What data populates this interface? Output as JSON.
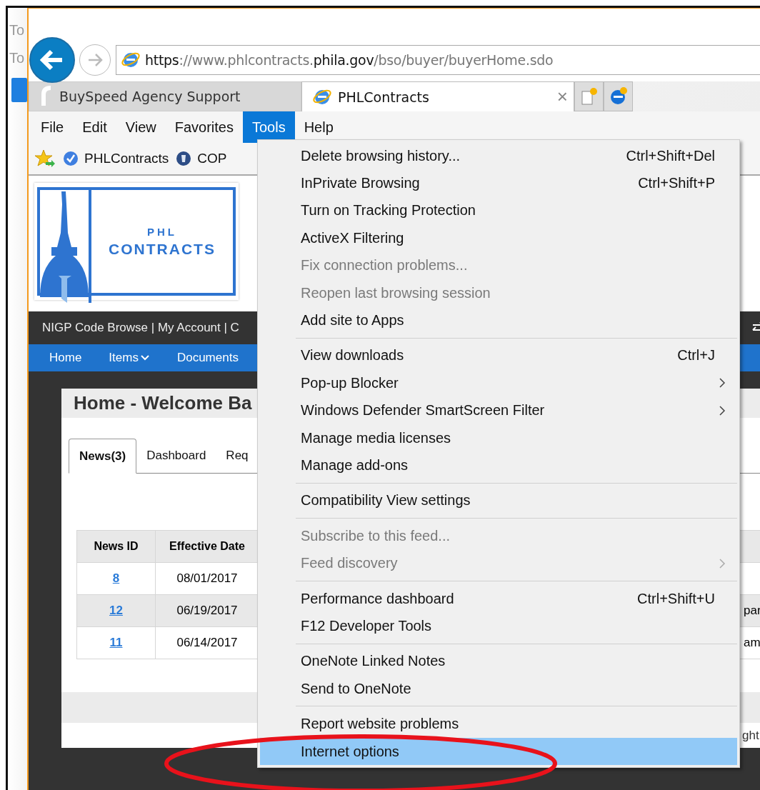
{
  "background_window": {
    "fragments": [
      "To",
      "To"
    ]
  },
  "browser": {
    "address": {
      "url_parts": [
        {
          "text": "https",
          "strong": true
        },
        {
          "text": "://www.phlcontracts.",
          "strong": false
        },
        {
          "text": "phila.gov",
          "strong": true
        },
        {
          "text": "/bso/buyer/buyerHome.sdo",
          "strong": false
        }
      ]
    },
    "tabs": [
      {
        "title": "BuySpeed Agency Support",
        "selected": false
      },
      {
        "title": "PHLContracts",
        "selected": true,
        "close": "×"
      }
    ],
    "menu_bar": [
      {
        "label": "File",
        "selected": false
      },
      {
        "label": "Edit",
        "selected": false
      },
      {
        "label": "View",
        "selected": false
      },
      {
        "label": "Favorites",
        "selected": false
      },
      {
        "label": "Tools",
        "selected": true
      },
      {
        "label": "Help",
        "selected": false
      }
    ],
    "favorites": [
      {
        "label": "PHLContracts",
        "kind": "check"
      },
      {
        "label": "COP",
        "kind": "globe"
      }
    ]
  },
  "page": {
    "logo": {
      "line1": "PHL",
      "line2": "CONTRACTS"
    },
    "top_links": "NIGP Code Browse | My Account | C",
    "nav": [
      {
        "label": "Home",
        "dropdown": false
      },
      {
        "label": "Items",
        "dropdown": true
      },
      {
        "label": "Documents",
        "dropdown": false
      }
    ],
    "card": {
      "title": "Home - Welcome Ba",
      "tabs": [
        {
          "label": "News(3)",
          "selected": true
        },
        {
          "label": "Dashboard",
          "selected": false
        },
        {
          "label": "Req",
          "selected": false
        }
      ],
      "table": {
        "columns": [
          "News ID",
          "Effective Date"
        ],
        "rows": [
          {
            "news_id": "8",
            "effective_date": "08/01/2017"
          },
          {
            "news_id": "12",
            "effective_date": "06/19/2017",
            "column_3": "par"
          },
          {
            "news_id": "11",
            "effective_date": "06/14/2017",
            "column_3": "am"
          }
        ]
      },
      "footer_fragment": "ght"
    }
  },
  "tools_menu": {
    "groups": [
      [
        {
          "label": "Delete browsing history...",
          "shortcut": "Ctrl+Shift+Del",
          "disabled": false,
          "submenu": false,
          "selected": false
        },
        {
          "label": "InPrivate Browsing",
          "shortcut": "Ctrl+Shift+P",
          "disabled": false,
          "submenu": false,
          "selected": false
        },
        {
          "label": "Turn on Tracking Protection",
          "disabled": false,
          "submenu": false,
          "selected": false
        },
        {
          "label": "ActiveX Filtering",
          "disabled": false,
          "submenu": false,
          "selected": false
        },
        {
          "label": "Fix connection problems...",
          "disabled": true,
          "submenu": false,
          "selected": false
        },
        {
          "label": "Reopen last browsing session",
          "disabled": true,
          "submenu": false,
          "selected": false
        },
        {
          "label": "Add site to Apps",
          "disabled": false,
          "submenu": false,
          "selected": false
        }
      ],
      [
        {
          "label": "View downloads",
          "shortcut": "Ctrl+J",
          "disabled": false,
          "submenu": false,
          "selected": false
        },
        {
          "label": "Pop-up Blocker",
          "disabled": false,
          "submenu": true,
          "selected": false
        },
        {
          "label": "Windows Defender SmartScreen Filter",
          "disabled": false,
          "submenu": true,
          "selected": false
        },
        {
          "label": "Manage media licenses",
          "disabled": false,
          "submenu": false,
          "selected": false
        },
        {
          "label": "Manage add-ons",
          "disabled": false,
          "submenu": false,
          "selected": false
        }
      ],
      [
        {
          "label": "Compatibility View settings",
          "disabled": false,
          "submenu": false,
          "selected": false
        }
      ],
      [
        {
          "label": "Subscribe to this feed...",
          "disabled": true,
          "submenu": false,
          "selected": false
        },
        {
          "label": "Feed discovery",
          "disabled": true,
          "submenu": true,
          "selected": false
        }
      ],
      [
        {
          "label": "Performance dashboard",
          "shortcut": "Ctrl+Shift+U",
          "disabled": false,
          "submenu": false,
          "selected": false
        },
        {
          "label": "F12 Developer Tools",
          "disabled": false,
          "submenu": false,
          "selected": false
        }
      ],
      [
        {
          "label": "OneNote Linked Notes",
          "disabled": false,
          "submenu": false,
          "selected": false
        },
        {
          "label": "Send to OneNote",
          "disabled": false,
          "submenu": false,
          "selected": false
        }
      ],
      [
        {
          "label": "Report website problems",
          "disabled": false,
          "submenu": false,
          "selected": false
        },
        {
          "label": "Internet options",
          "disabled": false,
          "submenu": false,
          "selected": true
        }
      ]
    ]
  }
}
